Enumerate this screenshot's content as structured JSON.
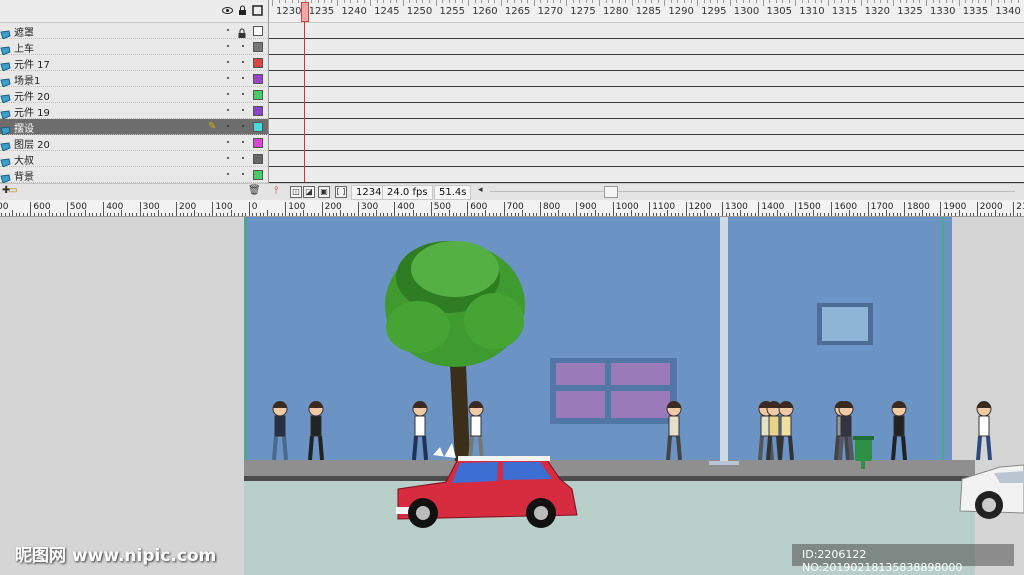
{
  "timeline": {
    "header_icons": [
      "eye-icon",
      "lock-icon",
      "outline-icon"
    ],
    "frame_numbers": [
      "1230",
      "1235",
      "1240",
      "1245",
      "1250",
      "1255",
      "1260",
      "1265",
      "1270",
      "1275",
      "1280",
      "1285",
      "1290",
      "1295",
      "1300",
      "1305",
      "1310",
      "1315",
      "1320",
      "1325",
      "1330",
      "1335",
      "1340"
    ],
    "layers": [
      {
        "name": "遮罩",
        "color": "#ffffff",
        "selected": false,
        "locked": true
      },
      {
        "name": "上车",
        "color": "#777777",
        "selected": false,
        "locked": false
      },
      {
        "name": "元件 17",
        "color": "#dd4444",
        "selected": false,
        "locked": false
      },
      {
        "name": "场景1",
        "color": "#9944cc",
        "selected": false,
        "locked": false
      },
      {
        "name": "元件 20",
        "color": "#44cc66",
        "selected": false,
        "locked": false
      },
      {
        "name": "元件 19",
        "color": "#8844cc",
        "selected": false,
        "locked": false
      },
      {
        "name": "摆设",
        "color": "#44dddd",
        "selected": true,
        "locked": false
      },
      {
        "name": "图层 20",
        "color": "#dd44dd",
        "selected": false,
        "locked": false
      },
      {
        "name": "大叔",
        "color": "#666666",
        "selected": false,
        "locked": false
      },
      {
        "name": "背景",
        "color": "#44cc66",
        "selected": false,
        "locked": false
      }
    ],
    "footer": {
      "current_frame": "1234",
      "frame_rate": "24.0 fps",
      "elapsed_time": "51.4s"
    }
  },
  "ruler": {
    "labels": [
      "00",
      "600",
      "500",
      "400",
      "300",
      "200",
      "100",
      "0",
      "100",
      "200",
      "300",
      "400",
      "500",
      "600",
      "700",
      "800",
      "900",
      "1000",
      "1100",
      "1200",
      "1300",
      "1400",
      "1500",
      "1600",
      "1700",
      "1800",
      "1900",
      "2000",
      "210"
    ]
  },
  "watermarks": {
    "site": "昵图网 www.nipic.com",
    "id": "ID:2206122 NO:20190218135838898000"
  },
  "colors": {
    "sky": "#6b93c4",
    "sidewalk": "#8f8f8f",
    "road": "#b7cfc8",
    "car": "#d72b3f",
    "tree": "#3f9a2f",
    "window": "#9a7ab8"
  }
}
